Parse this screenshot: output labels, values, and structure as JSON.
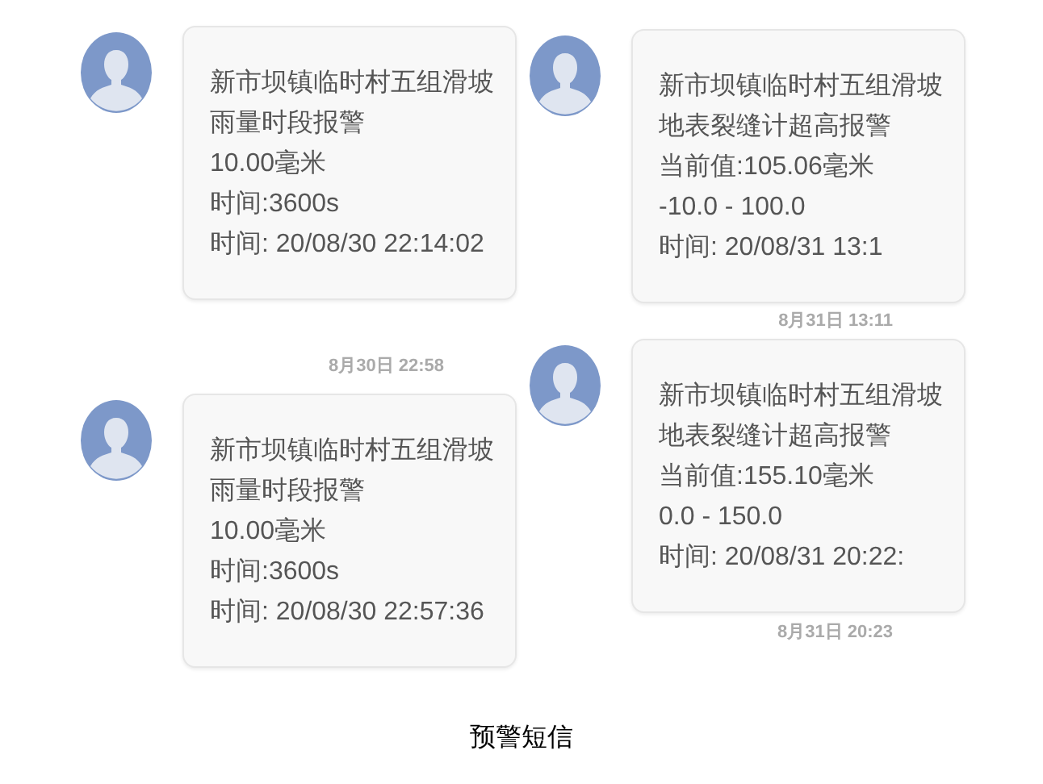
{
  "columns": [
    {
      "items": [
        {
          "kind": "message",
          "lines": [
            "新市坝镇临时村五组滑坡",
            "雨量时段报警",
            "10.00毫米",
            "时间:3600s",
            "时间: 20/08/30 22:14:02"
          ]
        },
        {
          "kind": "timestamp",
          "text": "8月30日 22:58"
        },
        {
          "kind": "message",
          "lines": [
            "新市坝镇临时村五组滑坡",
            "雨量时段报警",
            "10.00毫米",
            "时间:3600s",
            "时间: 20/08/30 22:57:36"
          ]
        }
      ]
    },
    {
      "items": [
        {
          "kind": "message",
          "lines": [
            "新市坝镇临时村五组滑坡",
            "地表裂缝计超高报警",
            "当前值:105.06毫米",
            "-10.0 - 100.0",
            "时间: 20/08/31 13:1"
          ]
        },
        {
          "kind": "timestamp",
          "text": "8月31日 13:11"
        },
        {
          "kind": "message",
          "lines": [
            "新市坝镇临时村五组滑坡",
            "地表裂缝计超高报警",
            "当前值:155.10毫米",
            "0.0 - 150.0",
            "时间: 20/08/31 20:22:"
          ]
        },
        {
          "kind": "timestamp",
          "text": "8月31日 20:23"
        }
      ]
    }
  ],
  "caption": "预警短信"
}
